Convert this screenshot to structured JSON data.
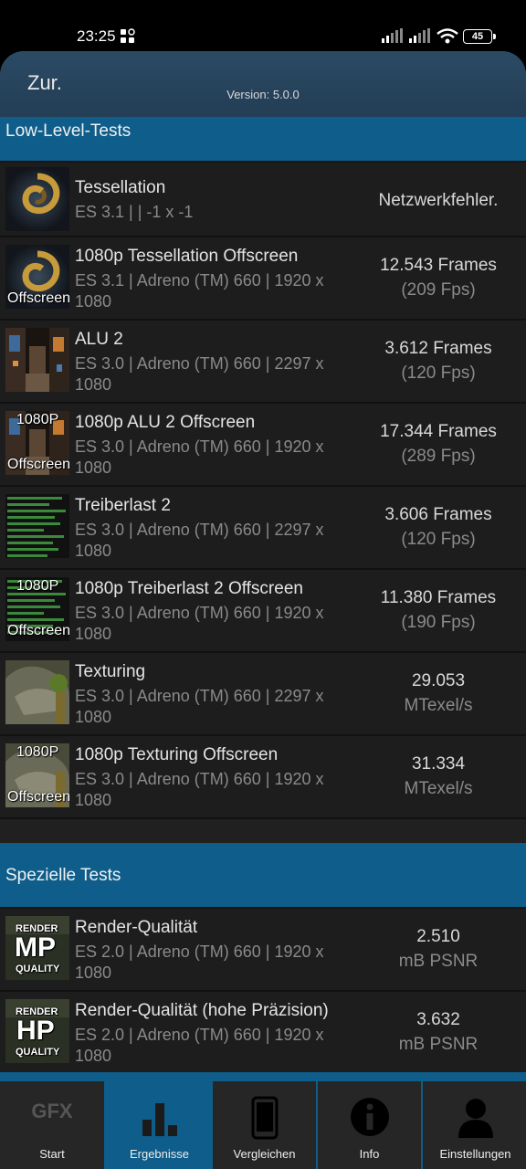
{
  "status": {
    "time": "23:25",
    "battery": "45"
  },
  "header": {
    "back_label": "Zur.",
    "version": "Version: 5.0.0"
  },
  "sections": {
    "low_level": "Low-Level-Tests",
    "special": "Spezielle Tests"
  },
  "tests": [
    {
      "title": "Tessellation",
      "sub": "ES 3.1 |  | -1 x -1",
      "result1": "Netzwerkfehler.",
      "result2": ""
    },
    {
      "title": "1080p Tessellation Offscreen",
      "sub": "ES 3.1 | Adreno (TM) 660 | 1920 x 1080",
      "result1": "12.543 Frames",
      "result2": "(209 Fps)"
    },
    {
      "title": "ALU 2",
      "sub": "ES 3.0 | Adreno (TM) 660 | 2297 x 1080",
      "result1": "3.612 Frames",
      "result2": "(120 Fps)"
    },
    {
      "title": "1080p ALU 2 Offscreen",
      "sub": "ES 3.0 | Adreno (TM) 660 | 1920 x 1080",
      "result1": "17.344 Frames",
      "result2": "(289 Fps)"
    },
    {
      "title": "Treiberlast 2",
      "sub": "ES 3.0 | Adreno (TM) 660 | 2297 x 1080",
      "result1": "3.606 Frames",
      "result2": "(120 Fps)"
    },
    {
      "title": "1080p Treiberlast 2 Offscreen",
      "sub": "ES 3.0 | Adreno (TM) 660 | 1920 x 1080",
      "result1": "11.380 Frames",
      "result2": "(190 Fps)"
    },
    {
      "title": "Texturing",
      "sub": "ES 3.0 | Adreno (TM) 660 | 2297 x 1080",
      "result1": "29.053",
      "result2": "MTexel/s"
    },
    {
      "title": "1080p Texturing Offscreen",
      "sub": "ES 3.0 | Adreno (TM) 660 | 1920 x 1080",
      "result1": "31.334",
      "result2": "MTexel/s"
    },
    {
      "title": "Render-Qualität",
      "sub": "ES 2.0 | Adreno (TM) 660 | 1920 x 1080",
      "result1": "2.510",
      "result2": "mB PSNR"
    },
    {
      "title": "Render-Qualität (hohe Präzision)",
      "sub": "ES 2.0 | Adreno (TM) 660 | 1920 x 1080",
      "result1": "3.632",
      "result2": "mB PSNR"
    }
  ],
  "thumb_labels": {
    "offscreen": "Offscreen",
    "p1080": "1080P",
    "render": "RENDER",
    "quality": "QUALITY",
    "mp": "MP",
    "hp": "HP"
  },
  "nav": [
    {
      "label": "Start",
      "icon": "gfx-logo-icon",
      "icon_text": "GFX"
    },
    {
      "label": "Ergebnisse",
      "icon": "bar-chart-icon"
    },
    {
      "label": "Vergleichen",
      "icon": "phone-icon"
    },
    {
      "label": "Info",
      "icon": "info-icon"
    },
    {
      "label": "Einstellungen",
      "icon": "user-icon"
    }
  ],
  "colors": {
    "accent": "#0e5d8a",
    "header": "#2b4a64",
    "row_bg": "#1d1d1d"
  }
}
